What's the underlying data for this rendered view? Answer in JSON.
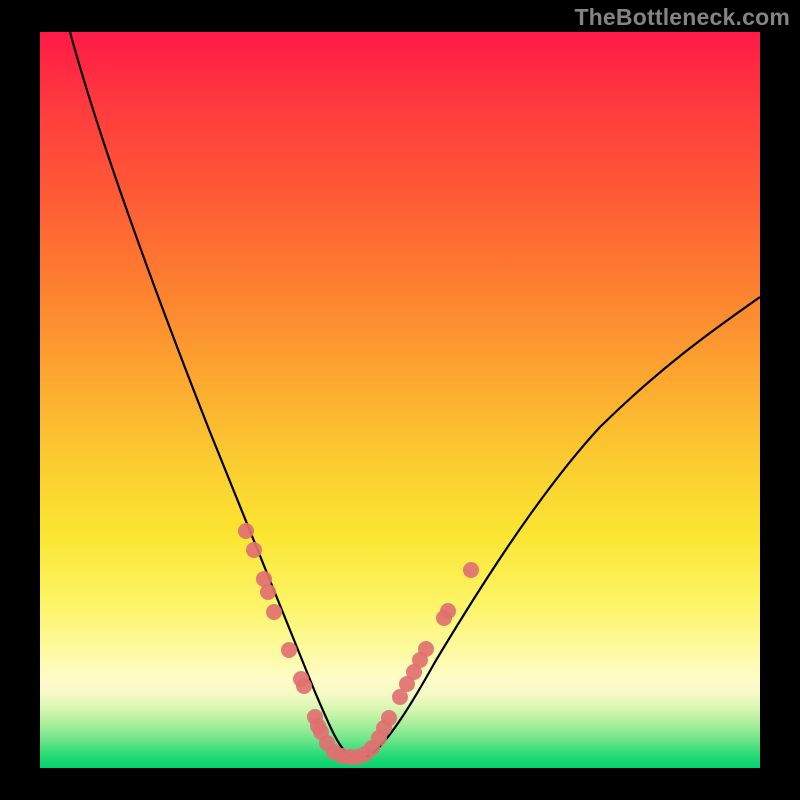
{
  "watermark": "TheBottleneck.com",
  "chart_data": {
    "type": "line",
    "title": "",
    "xlabel": "",
    "ylabel": "",
    "xlim": [
      0,
      100
    ],
    "ylim": [
      0,
      100
    ],
    "curve_note": "V-shaped curve with minimum near x≈42; values estimated from pixel positions on a 0–100 range",
    "series": [
      {
        "name": "main-curve",
        "x": [
          4,
          8,
          12,
          16,
          20,
          24,
          28,
          32,
          36,
          40,
          42,
          44,
          48,
          52,
          56,
          60,
          64,
          70,
          76,
          82,
          88,
          94,
          100
        ],
        "y": [
          100,
          86,
          73,
          62,
          52,
          43,
          33,
          23,
          13,
          4,
          1,
          1,
          6,
          12,
          18,
          24,
          29,
          36,
          42,
          48,
          54,
          59,
          64
        ]
      }
    ],
    "markers": {
      "name": "highlight-points",
      "color": "#e17070",
      "points": [
        {
          "x": 28.5,
          "y": 32
        },
        {
          "x": 29.5,
          "y": 29
        },
        {
          "x": 31.0,
          "y": 25
        },
        {
          "x": 31.5,
          "y": 23
        },
        {
          "x": 32.5,
          "y": 20
        },
        {
          "x": 34.5,
          "y": 15
        },
        {
          "x": 36.0,
          "y": 11
        },
        {
          "x": 36.5,
          "y": 10
        },
        {
          "x": 38.0,
          "y": 5
        },
        {
          "x": 38.5,
          "y": 4
        },
        {
          "x": 39.0,
          "y": 3
        },
        {
          "x": 40.0,
          "y": 2
        },
        {
          "x": 41.0,
          "y": 1
        },
        {
          "x": 42.0,
          "y": 1
        },
        {
          "x": 43.0,
          "y": 1
        },
        {
          "x": 44.0,
          "y": 1
        },
        {
          "x": 45.0,
          "y": 1.5
        },
        {
          "x": 46.0,
          "y": 2.5
        },
        {
          "x": 47.0,
          "y": 4
        },
        {
          "x": 47.8,
          "y": 5.5
        },
        {
          "x": 48.5,
          "y": 7
        },
        {
          "x": 50.0,
          "y": 10
        },
        {
          "x": 51.0,
          "y": 12
        },
        {
          "x": 52.0,
          "y": 13.5
        },
        {
          "x": 52.8,
          "y": 15
        },
        {
          "x": 53.5,
          "y": 16.5
        },
        {
          "x": 56.0,
          "y": 20.5
        },
        {
          "x": 56.5,
          "y": 21.5
        },
        {
          "x": 60.0,
          "y": 27
        }
      ]
    },
    "background_gradient": {
      "top": "#ff1a47",
      "mid_upper": "#fca430",
      "mid": "#fbe531",
      "mid_lower": "#fdfaa0",
      "bottom": "#00d26e"
    }
  }
}
